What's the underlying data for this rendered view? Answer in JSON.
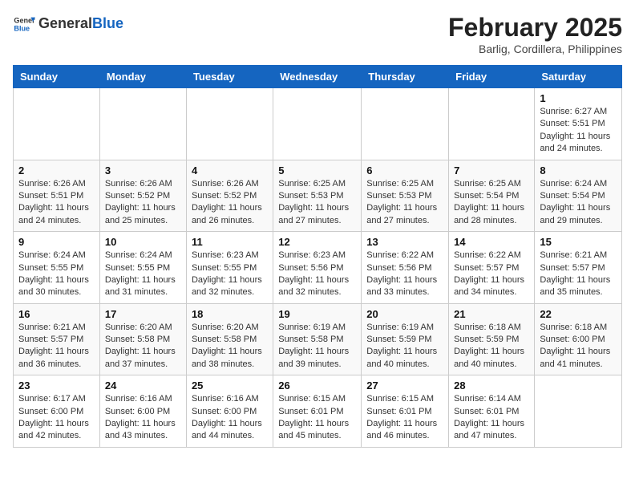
{
  "header": {
    "logo_general": "General",
    "logo_blue": "Blue",
    "month_title": "February 2025",
    "location": "Barlig, Cordillera, Philippines"
  },
  "weekdays": [
    "Sunday",
    "Monday",
    "Tuesday",
    "Wednesday",
    "Thursday",
    "Friday",
    "Saturday"
  ],
  "weeks": [
    [
      {
        "day": "",
        "info": ""
      },
      {
        "day": "",
        "info": ""
      },
      {
        "day": "",
        "info": ""
      },
      {
        "day": "",
        "info": ""
      },
      {
        "day": "",
        "info": ""
      },
      {
        "day": "",
        "info": ""
      },
      {
        "day": "1",
        "info": "Sunrise: 6:27 AM\nSunset: 5:51 PM\nDaylight: 11 hours and 24 minutes."
      }
    ],
    [
      {
        "day": "2",
        "info": "Sunrise: 6:26 AM\nSunset: 5:51 PM\nDaylight: 11 hours and 24 minutes."
      },
      {
        "day": "3",
        "info": "Sunrise: 6:26 AM\nSunset: 5:52 PM\nDaylight: 11 hours and 25 minutes."
      },
      {
        "day": "4",
        "info": "Sunrise: 6:26 AM\nSunset: 5:52 PM\nDaylight: 11 hours and 26 minutes."
      },
      {
        "day": "5",
        "info": "Sunrise: 6:25 AM\nSunset: 5:53 PM\nDaylight: 11 hours and 27 minutes."
      },
      {
        "day": "6",
        "info": "Sunrise: 6:25 AM\nSunset: 5:53 PM\nDaylight: 11 hours and 27 minutes."
      },
      {
        "day": "7",
        "info": "Sunrise: 6:25 AM\nSunset: 5:54 PM\nDaylight: 11 hours and 28 minutes."
      },
      {
        "day": "8",
        "info": "Sunrise: 6:24 AM\nSunset: 5:54 PM\nDaylight: 11 hours and 29 minutes."
      }
    ],
    [
      {
        "day": "9",
        "info": "Sunrise: 6:24 AM\nSunset: 5:55 PM\nDaylight: 11 hours and 30 minutes."
      },
      {
        "day": "10",
        "info": "Sunrise: 6:24 AM\nSunset: 5:55 PM\nDaylight: 11 hours and 31 minutes."
      },
      {
        "day": "11",
        "info": "Sunrise: 6:23 AM\nSunset: 5:55 PM\nDaylight: 11 hours and 32 minutes."
      },
      {
        "day": "12",
        "info": "Sunrise: 6:23 AM\nSunset: 5:56 PM\nDaylight: 11 hours and 32 minutes."
      },
      {
        "day": "13",
        "info": "Sunrise: 6:22 AM\nSunset: 5:56 PM\nDaylight: 11 hours and 33 minutes."
      },
      {
        "day": "14",
        "info": "Sunrise: 6:22 AM\nSunset: 5:57 PM\nDaylight: 11 hours and 34 minutes."
      },
      {
        "day": "15",
        "info": "Sunrise: 6:21 AM\nSunset: 5:57 PM\nDaylight: 11 hours and 35 minutes."
      }
    ],
    [
      {
        "day": "16",
        "info": "Sunrise: 6:21 AM\nSunset: 5:57 PM\nDaylight: 11 hours and 36 minutes."
      },
      {
        "day": "17",
        "info": "Sunrise: 6:20 AM\nSunset: 5:58 PM\nDaylight: 11 hours and 37 minutes."
      },
      {
        "day": "18",
        "info": "Sunrise: 6:20 AM\nSunset: 5:58 PM\nDaylight: 11 hours and 38 minutes."
      },
      {
        "day": "19",
        "info": "Sunrise: 6:19 AM\nSunset: 5:58 PM\nDaylight: 11 hours and 39 minutes."
      },
      {
        "day": "20",
        "info": "Sunrise: 6:19 AM\nSunset: 5:59 PM\nDaylight: 11 hours and 40 minutes."
      },
      {
        "day": "21",
        "info": "Sunrise: 6:18 AM\nSunset: 5:59 PM\nDaylight: 11 hours and 40 minutes."
      },
      {
        "day": "22",
        "info": "Sunrise: 6:18 AM\nSunset: 6:00 PM\nDaylight: 11 hours and 41 minutes."
      }
    ],
    [
      {
        "day": "23",
        "info": "Sunrise: 6:17 AM\nSunset: 6:00 PM\nDaylight: 11 hours and 42 minutes."
      },
      {
        "day": "24",
        "info": "Sunrise: 6:16 AM\nSunset: 6:00 PM\nDaylight: 11 hours and 43 minutes."
      },
      {
        "day": "25",
        "info": "Sunrise: 6:16 AM\nSunset: 6:00 PM\nDaylight: 11 hours and 44 minutes."
      },
      {
        "day": "26",
        "info": "Sunrise: 6:15 AM\nSunset: 6:01 PM\nDaylight: 11 hours and 45 minutes."
      },
      {
        "day": "27",
        "info": "Sunrise: 6:15 AM\nSunset: 6:01 PM\nDaylight: 11 hours and 46 minutes."
      },
      {
        "day": "28",
        "info": "Sunrise: 6:14 AM\nSunset: 6:01 PM\nDaylight: 11 hours and 47 minutes."
      },
      {
        "day": "",
        "info": ""
      }
    ]
  ]
}
